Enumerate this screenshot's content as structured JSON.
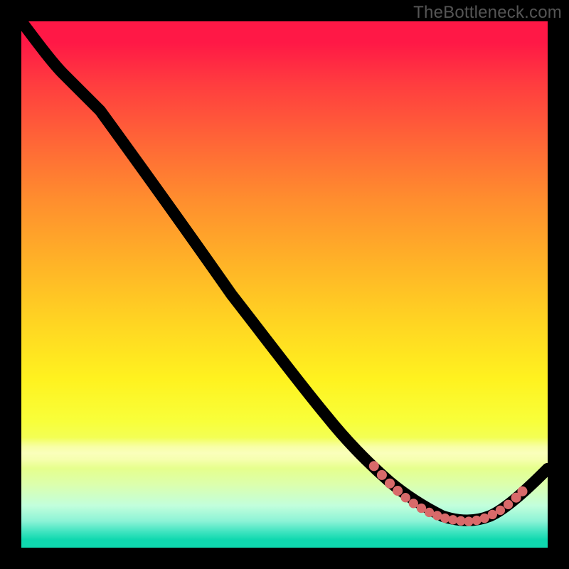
{
  "watermark": "TheBottleneck.com",
  "chart_data": {
    "type": "line",
    "title": "",
    "xlabel": "",
    "ylabel": "",
    "x_range_normalized": [
      0,
      100
    ],
    "y_range_normalized": [
      0,
      100
    ],
    "notes": "Axes/ticks not shown; values are normalized 0–100 in plot-area coordinates (0 at top-left). Main curve descends from top-left, reaching a minimum (best) near x≈80 then rising slightly. A dotted highlight marks the low-bottleneck region.",
    "series": [
      {
        "name": "curve",
        "kind": "line",
        "x": [
          0,
          4,
          8,
          13,
          20,
          30,
          40,
          50,
          58,
          65,
          70,
          75,
          80,
          85,
          90,
          95,
          100
        ],
        "y": [
          0,
          5,
          10,
          15,
          24,
          38,
          52,
          65,
          75,
          82,
          87,
          91,
          94,
          95,
          94,
          90,
          85
        ]
      },
      {
        "name": "low-bottleneck-region",
        "kind": "dotted",
        "x": [
          67,
          69,
          71,
          73,
          75,
          77,
          79,
          81,
          83,
          85,
          87,
          89,
          91,
          93,
          95
        ],
        "y": [
          84.5,
          87.3,
          89.5,
          91.1,
          92.3,
          93.3,
          94.0,
          94.5,
          94.8,
          95.0,
          94.7,
          94.0,
          93.0,
          91.5,
          90.0
        ]
      }
    ],
    "gradient_stops": [
      {
        "pos": 0,
        "color": "#ff1846"
      },
      {
        "pos": 0.35,
        "color": "#ff8e2e"
      },
      {
        "pos": 0.7,
        "color": "#fff21f"
      },
      {
        "pos": 0.88,
        "color": "#dcffad"
      },
      {
        "pos": 1.0,
        "color": "#0fd8af"
      }
    ]
  }
}
